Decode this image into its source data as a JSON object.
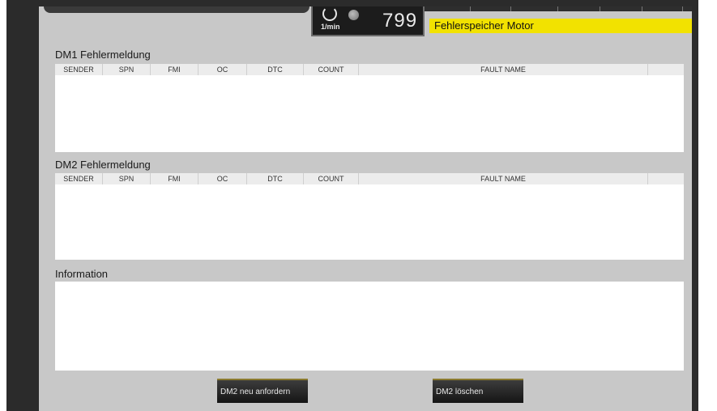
{
  "gauge": {
    "unit": "1/min",
    "value": "799"
  },
  "page_title": "Fehlerspeicher Motor",
  "dm1": {
    "title": "DM1 Fehlermeldung",
    "columns": [
      "SENDER",
      "SPN",
      "FMI",
      "OC",
      "DTC",
      "COUNT",
      "FAULT NAME"
    ]
  },
  "dm2": {
    "title": "DM2 Fehlermeldung",
    "columns": [
      "SENDER",
      "SPN",
      "FMI",
      "OC",
      "DTC",
      "COUNT",
      "FAULT NAME"
    ]
  },
  "information": {
    "title": "Information"
  },
  "buttons": {
    "request_dm2": "DM2 neu anfordern",
    "clear_dm2": "DM2 löschen"
  },
  "colors": {
    "title_bar": "#f2e200",
    "panel": "#c8c8c8",
    "button": "#1f1f1f"
  }
}
